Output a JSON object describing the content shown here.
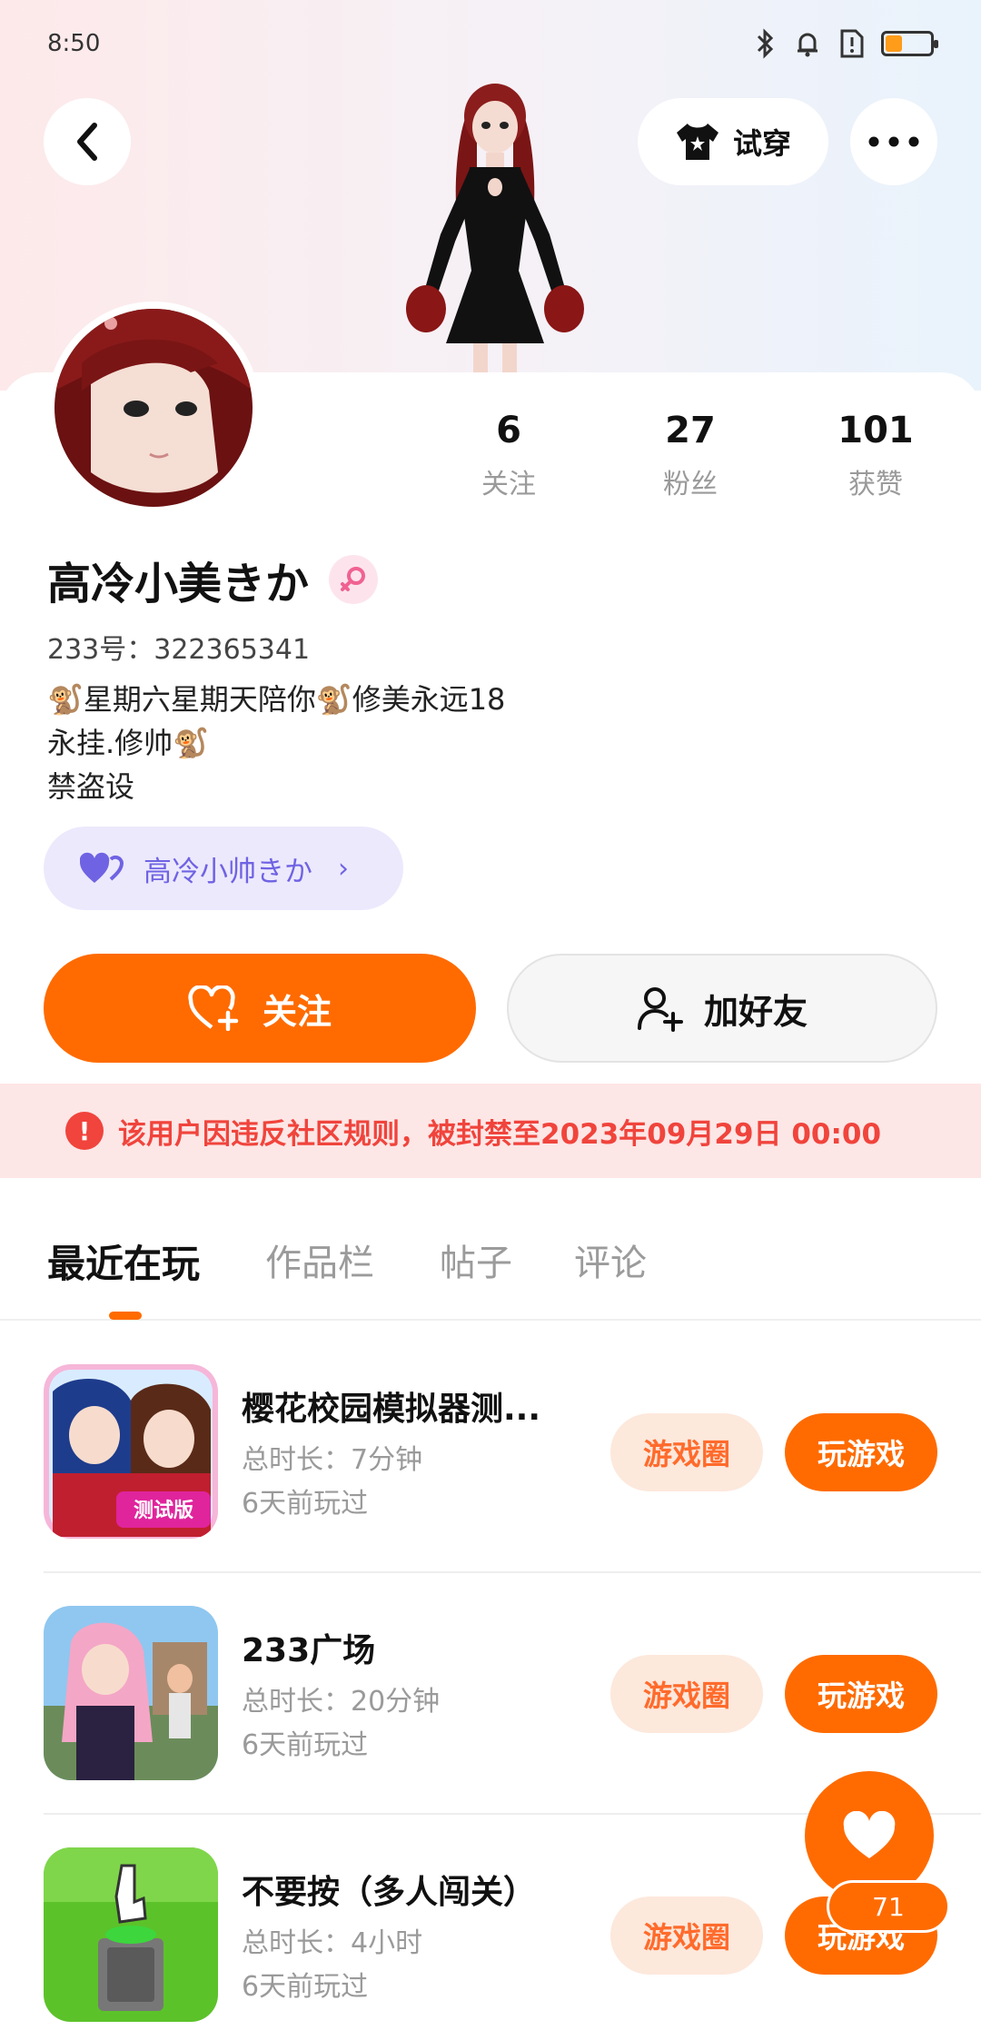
{
  "status_bar": {
    "time": "8:50",
    "battery_level": 0.35
  },
  "header": {
    "try_on_label": "试穿"
  },
  "profile": {
    "nickname": "高冷小美きか",
    "uid_text": "233号：322365341",
    "bio_lines": [
      "🐒星期六星期天陪你🐒修美永远18",
      "永挂.修帅🐒",
      "禁盗设"
    ],
    "cp_name": "高冷小帅きか"
  },
  "stats": [
    {
      "value": "6",
      "label": "关注"
    },
    {
      "value": "27",
      "label": "粉丝"
    },
    {
      "value": "101",
      "label": "获赞"
    }
  ],
  "actions": {
    "follow_label": "关注",
    "add_friend_label": "加好友"
  },
  "ban_notice": "该用户因违反社区规则，被封禁至2023年09月29日 00:00",
  "tabs": [
    {
      "label": "最近在玩",
      "active": true
    },
    {
      "label": "作品栏",
      "active": false
    },
    {
      "label": "帖子",
      "active": false
    },
    {
      "label": "评论",
      "active": false
    }
  ],
  "games": [
    {
      "title": "樱花校园模拟器测...",
      "duration": "总时长：7分钟",
      "last_played": "6天前玩过",
      "circle_label": "游戏圈",
      "play_label": "玩游戏"
    },
    {
      "title": "233广场",
      "duration": "总时长：20分钟",
      "last_played": "6天前玩过",
      "circle_label": "游戏圈",
      "play_label": "玩游戏"
    },
    {
      "title": "不要按（多人闯关）",
      "duration": "总时长：4小时",
      "last_played": "6天前玩过",
      "circle_label": "游戏圈",
      "play_label": "玩游戏"
    }
  ],
  "floating": {
    "like_count": "71"
  },
  "colors": {
    "accent": "#ff6b00",
    "ban_red": "#f0443c",
    "cp_purple": "#6f63e3"
  }
}
